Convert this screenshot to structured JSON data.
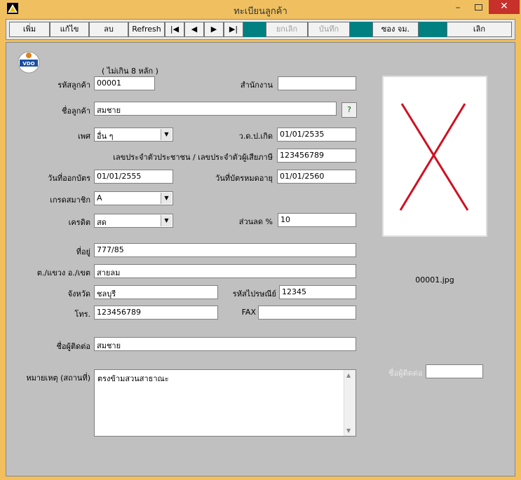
{
  "window": {
    "title": "ทะเบียนลูกค้า",
    "minimize": "–",
    "close": "✕"
  },
  "toolbar": {
    "add": "เพิ่ม",
    "edit": "แก้ไข",
    "delete": "ลบ",
    "refresh": "Refresh",
    "first": "|◀",
    "prev": "◀",
    "next": "▶",
    "last": "▶|",
    "cancel": "ยกเลิก",
    "save": "บันทึก",
    "envelope": "ซอง จม.",
    "exit": "เลิก"
  },
  "logo": {
    "text": "VDO"
  },
  "form": {
    "hint": "( ไม่เกิน 8 หลัก )",
    "customer_code": {
      "label": "รหัสลูกค้า",
      "value": "00001"
    },
    "branch": {
      "label": "สำนักงาน",
      "value": ""
    },
    "customer_name": {
      "label": "ชื่อลูกค้า",
      "value": "สมชาย"
    },
    "lookup_btn": "?",
    "gender": {
      "label": "เพศ",
      "value": "อื่น ๆ"
    },
    "birthdate": {
      "label": "ว.ด.ป.เกิด",
      "value": "01/01/2535"
    },
    "id_number": {
      "label": "เลขประจำตัวประชาชน / เลขประจำตัวผู้เสียภาษี",
      "value": "123456789"
    },
    "issue_date": {
      "label": "วันที่ออกบัตร",
      "value": "01/01/2555"
    },
    "expiry_date": {
      "label": "วันที่บัตรหมดอายุ",
      "value": "01/01/2560"
    },
    "member_grade": {
      "label": "เกรดสมาชิก",
      "value": "A"
    },
    "credit": {
      "label": "เครดิต",
      "value": "สด"
    },
    "discount": {
      "label": "ส่วนลด %",
      "value": "10"
    },
    "address": {
      "label": "ที่อยู่",
      "value": "777/85"
    },
    "subdistrict": {
      "label": "ต./แขวง อ./เขต",
      "value": "สายลม"
    },
    "province": {
      "label": "จังหวัด",
      "value": "ชลบุรี"
    },
    "postcode": {
      "label": "รหัสไปรษณีย์",
      "value": "12345"
    },
    "phone": {
      "label": "โทร.",
      "value": "123456789"
    },
    "fax": {
      "label": "FAX",
      "value": ""
    },
    "contact": {
      "label": "ชื่อผู้ติดต่อ",
      "value": "สมชาย"
    },
    "remark": {
      "label": "หมายเหตุ (สถานที่)",
      "value": "ตรงข้ามสวนสาธาณะ"
    },
    "photo_filename": "00001.jpg",
    "contact2": {
      "label": "ชื่อผู้ติดต่อ",
      "value": ""
    }
  },
  "colors": {
    "accent": "#008080",
    "title_bar": "#f0c060",
    "close": "#c7302b",
    "photo_mark": "#d01020"
  }
}
